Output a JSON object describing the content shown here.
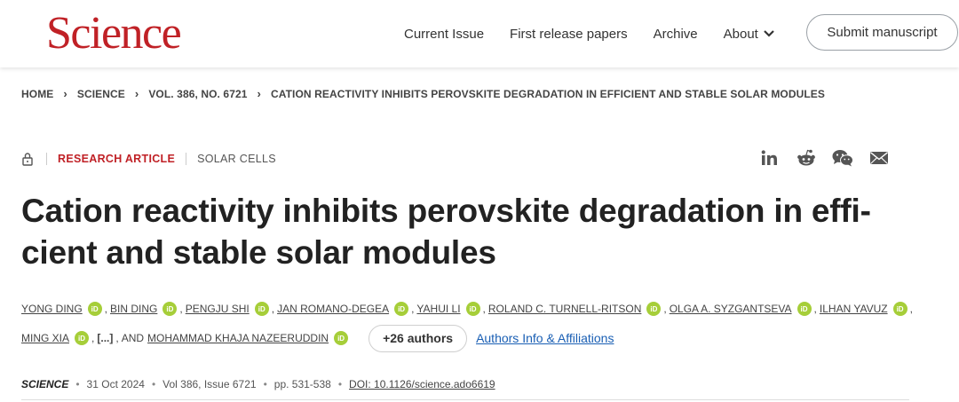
{
  "header": {
    "logo": "Science",
    "nav": [
      "Current Issue",
      "First release papers",
      "Archive",
      "About"
    ],
    "submit_label": "Submit manuscript"
  },
  "breadcrumb": [
    "HOME",
    "SCIENCE",
    "VOL. 386, NO. 6721",
    "CATION REACTIVITY INHIBITS PEROVSKITE DEGRADATION IN EFFICIENT AND STABLE SOLAR MODULES"
  ],
  "article": {
    "type": "RESEARCH ARTICLE",
    "topic": "SOLAR CELLS",
    "title": "Cation reactivity inhibits perovskite degradation in effi- cient and stable solar modules",
    "authors_line1": [
      "YONG DING",
      "BIN DING",
      "PENGJU SHI",
      "JAN ROMANO-DEGEA",
      "YAHUI LI",
      "ROLAND C. TURNELL-RITSON",
      "OLGA A. SYZGANTSEVA",
      "ILHAN YAVUZ"
    ],
    "authors_line2_first": "MING XIA",
    "ellipsis": "[...]",
    "and_label": "AND",
    "last_author": "MOHAMMAD KHAJA NAZEERUDDIN",
    "more_authors": "+26 authors",
    "affiliations_link": "Authors Info & Affiliations"
  },
  "pubinfo": {
    "journal": "SCIENCE",
    "date": "31 Oct 2024",
    "volume": "Vol 386, Issue 6721",
    "pages": "pp. 531-538",
    "doi": "DOI: 10.1126/science.ado6619"
  },
  "share_icons": [
    "linkedin-icon",
    "reddit-icon",
    "wechat-icon",
    "email-icon"
  ],
  "colors": {
    "brand": "#c02126",
    "orcid": "#a6ce39",
    "link": "#1a5fb4"
  }
}
